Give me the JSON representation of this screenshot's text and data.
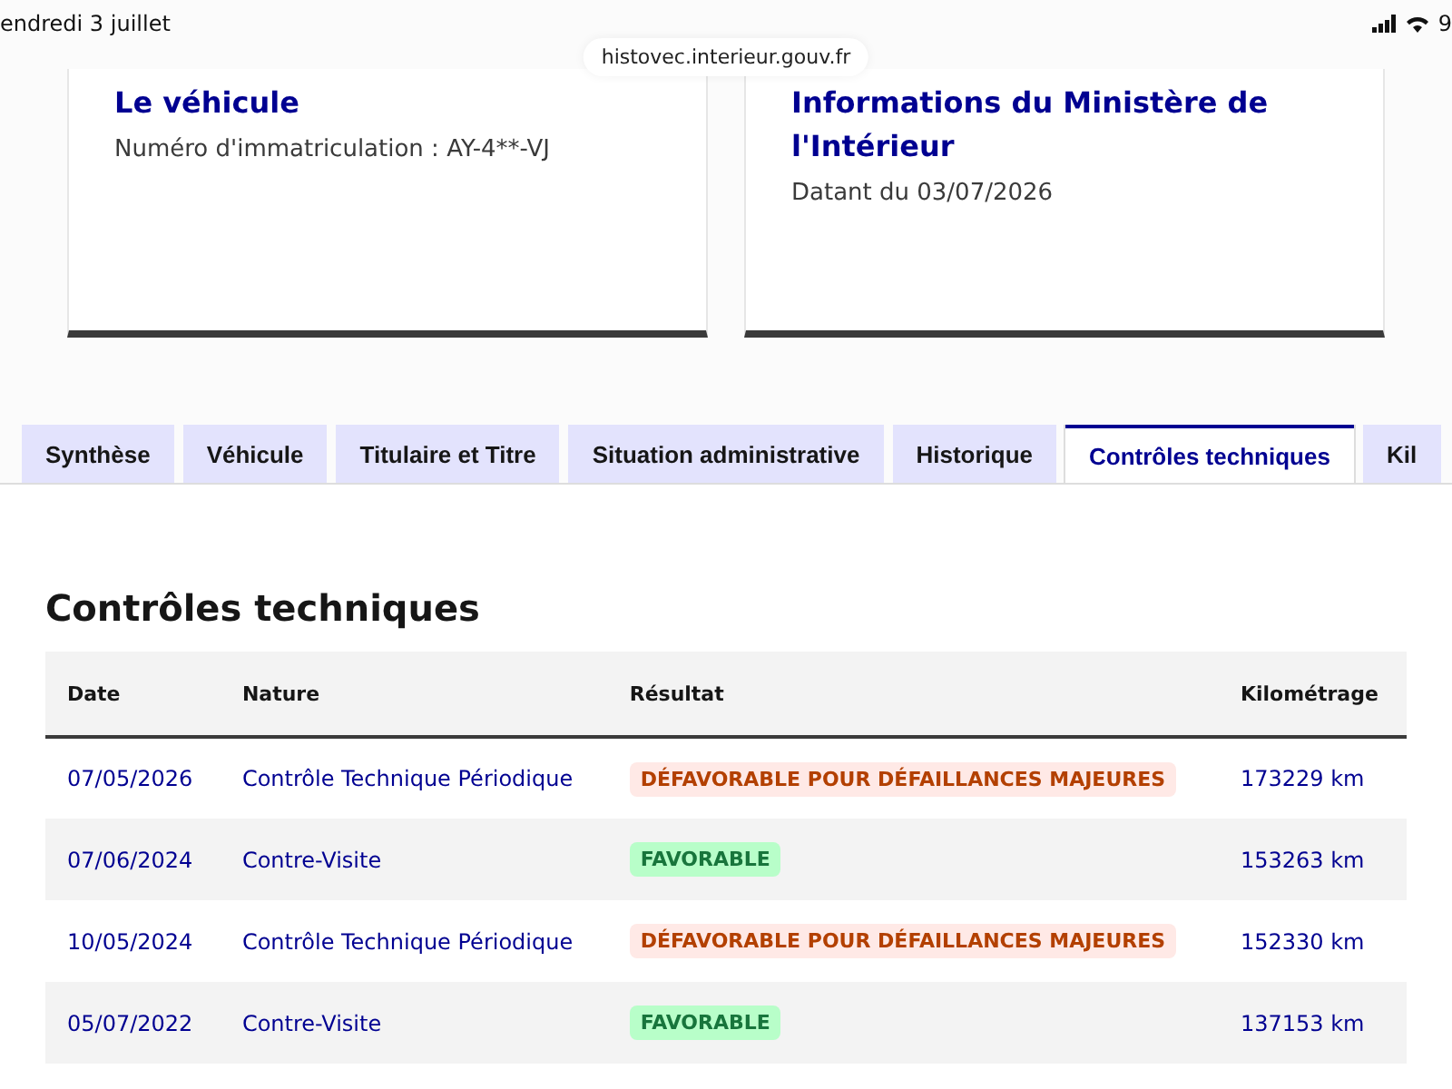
{
  "status_bar": {
    "date": "endredi 3 juillet",
    "battery": "9"
  },
  "address_bar": {
    "url": "histovec.interieur.gouv.fr"
  },
  "cards": [
    {
      "title": "Le véhicule",
      "text": "Numéro d'immatriculation : AY-4**-VJ"
    },
    {
      "title": "Informations du Ministère de l'Intérieur",
      "text": "Datant du 03/07/2026"
    }
  ],
  "tabs": [
    {
      "label": "Synthèse",
      "selected": false
    },
    {
      "label": "Véhicule",
      "selected": false
    },
    {
      "label": "Titulaire et Titre",
      "selected": false
    },
    {
      "label": "Situation administrative",
      "selected": false
    },
    {
      "label": "Historique",
      "selected": false
    },
    {
      "label": "Contrôles techniques",
      "selected": true
    },
    {
      "label": "Kil",
      "selected": false
    }
  ],
  "section": {
    "title": "Contrôles techniques"
  },
  "table": {
    "columns": [
      "Date",
      "Nature",
      "Résultat",
      "Kilométrage"
    ],
    "rows": [
      {
        "date": "07/05/2026",
        "nature": "Contrôle Technique Périodique",
        "result": "DÉFAVORABLE POUR DÉFAILLANCES MAJEURES",
        "kind": "unfavorable",
        "mileage": "173229 km"
      },
      {
        "date": "07/06/2024",
        "nature": "Contre-Visite",
        "result": "FAVORABLE",
        "kind": "favorable",
        "mileage": "153263 km"
      },
      {
        "date": "10/05/2024",
        "nature": "Contrôle Technique Périodique",
        "result": "DÉFAVORABLE POUR DÉFAILLANCES MAJEURES",
        "kind": "unfavorable",
        "mileage": "152330 km"
      },
      {
        "date": "05/07/2022",
        "nature": "Contre-Visite",
        "result": "FAVORABLE",
        "kind": "favorable",
        "mileage": "137153 km"
      }
    ]
  }
}
